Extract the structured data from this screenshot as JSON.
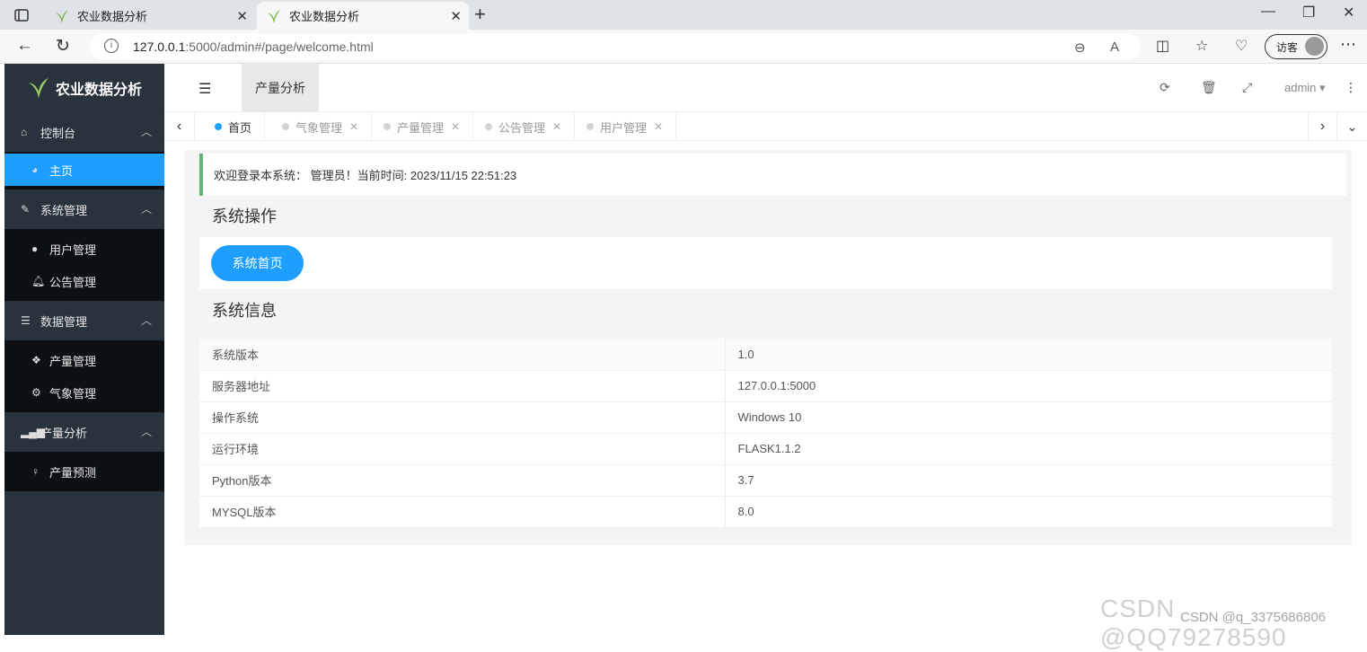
{
  "browser": {
    "tabs": [
      {
        "title": "农业数据分析"
      },
      {
        "title": "农业数据分析"
      }
    ],
    "url_host": "127.0.0.1",
    "url_rest": ":5000/admin#/page/welcome.html",
    "guest_label": "访客"
  },
  "app": {
    "logo_text": "农业数据分析",
    "sidebar": {
      "groups": [
        {
          "label": "控制台",
          "items": [
            {
              "label": "主页",
              "active": true
            }
          ]
        },
        {
          "label": "系统管理",
          "items": [
            {
              "label": "用户管理"
            },
            {
              "label": "公告管理"
            }
          ]
        },
        {
          "label": "数据管理",
          "items": [
            {
              "label": "产量管理"
            },
            {
              "label": "气象管理"
            }
          ]
        },
        {
          "label": "产量分析",
          "items": [
            {
              "label": "产量预测"
            }
          ]
        }
      ]
    },
    "header": {
      "active_tab": "产量分析",
      "user": "admin"
    },
    "page_tabs": [
      {
        "label": "首页",
        "active": true
      },
      {
        "label": "气象管理"
      },
      {
        "label": "产量管理"
      },
      {
        "label": "公告管理"
      },
      {
        "label": "用户管理"
      }
    ],
    "welcome_text": "欢迎登录本系统： 管理员！当前时间: 2023/11/15 22:51:23",
    "ops_title": "系统操作",
    "home_button": "系统首页",
    "info_title": "系统信息",
    "info_rows": [
      {
        "key": "系统版本",
        "value": "1.0"
      },
      {
        "key": "服务器地址",
        "value": "127.0.0.1:5000"
      },
      {
        "key": "操作系统",
        "value": "Windows 10"
      },
      {
        "key": "运行环境",
        "value": "FLASK1.1.2"
      },
      {
        "key": "Python版本",
        "value": "3.7"
      },
      {
        "key": "MYSQL版本",
        "value": "8.0"
      }
    ]
  },
  "watermark": "CSDN @QQ79278590",
  "watermark_small": "CSDN @q_3375686806",
  "colors": {
    "primary": "#1e9fff",
    "sidebar": "#28333e",
    "submenu": "#0c0f13",
    "welcome_border": "#5fb878"
  }
}
